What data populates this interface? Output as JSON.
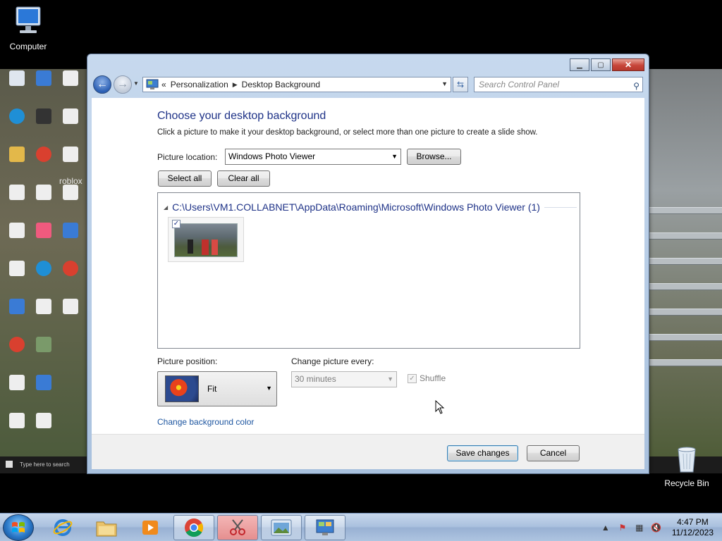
{
  "desktop": {
    "icons": {
      "computer": "Computer",
      "recycle_bin": "Recycle Bin"
    },
    "bg_watermark": "roblox",
    "bg_search_placeholder": "Type here to search"
  },
  "window": {
    "nav": {
      "breadcrumb_overflow": "«",
      "breadcrumb": [
        "Personalization",
        "Desktop Background"
      ],
      "search_placeholder": "Search Control Panel"
    },
    "content": {
      "title": "Choose your desktop background",
      "description": "Click a picture to make it your desktop background, or select more than one picture to create a slide show.",
      "picture_location_label": "Picture location:",
      "picture_location_value": "Windows Photo Viewer",
      "browse_label": "Browse...",
      "select_all_label": "Select all",
      "clear_all_label": "Clear all",
      "folder_path": "C:\\Users\\VM1.COLLABNET\\AppData\\Roaming\\Microsoft\\Windows Photo Viewer (1)",
      "thumbnail_checked": true,
      "picture_position_label": "Picture position:",
      "picture_position_value": "Fit",
      "change_every_label": "Change picture every:",
      "change_every_value": "30 minutes",
      "shuffle_label": "Shuffle",
      "shuffle_checked": true,
      "change_color_link": "Change background color"
    },
    "footer": {
      "save_label": "Save changes",
      "cancel_label": "Cancel"
    }
  },
  "taskbar": {
    "clock_time": "4:47 PM",
    "clock_date": "11/12/2023"
  },
  "colors": {
    "title_blue": "#1e3287",
    "link_blue": "#1e56a0",
    "taskbar": "#a9c0de",
    "close_red": "#c7463a"
  }
}
